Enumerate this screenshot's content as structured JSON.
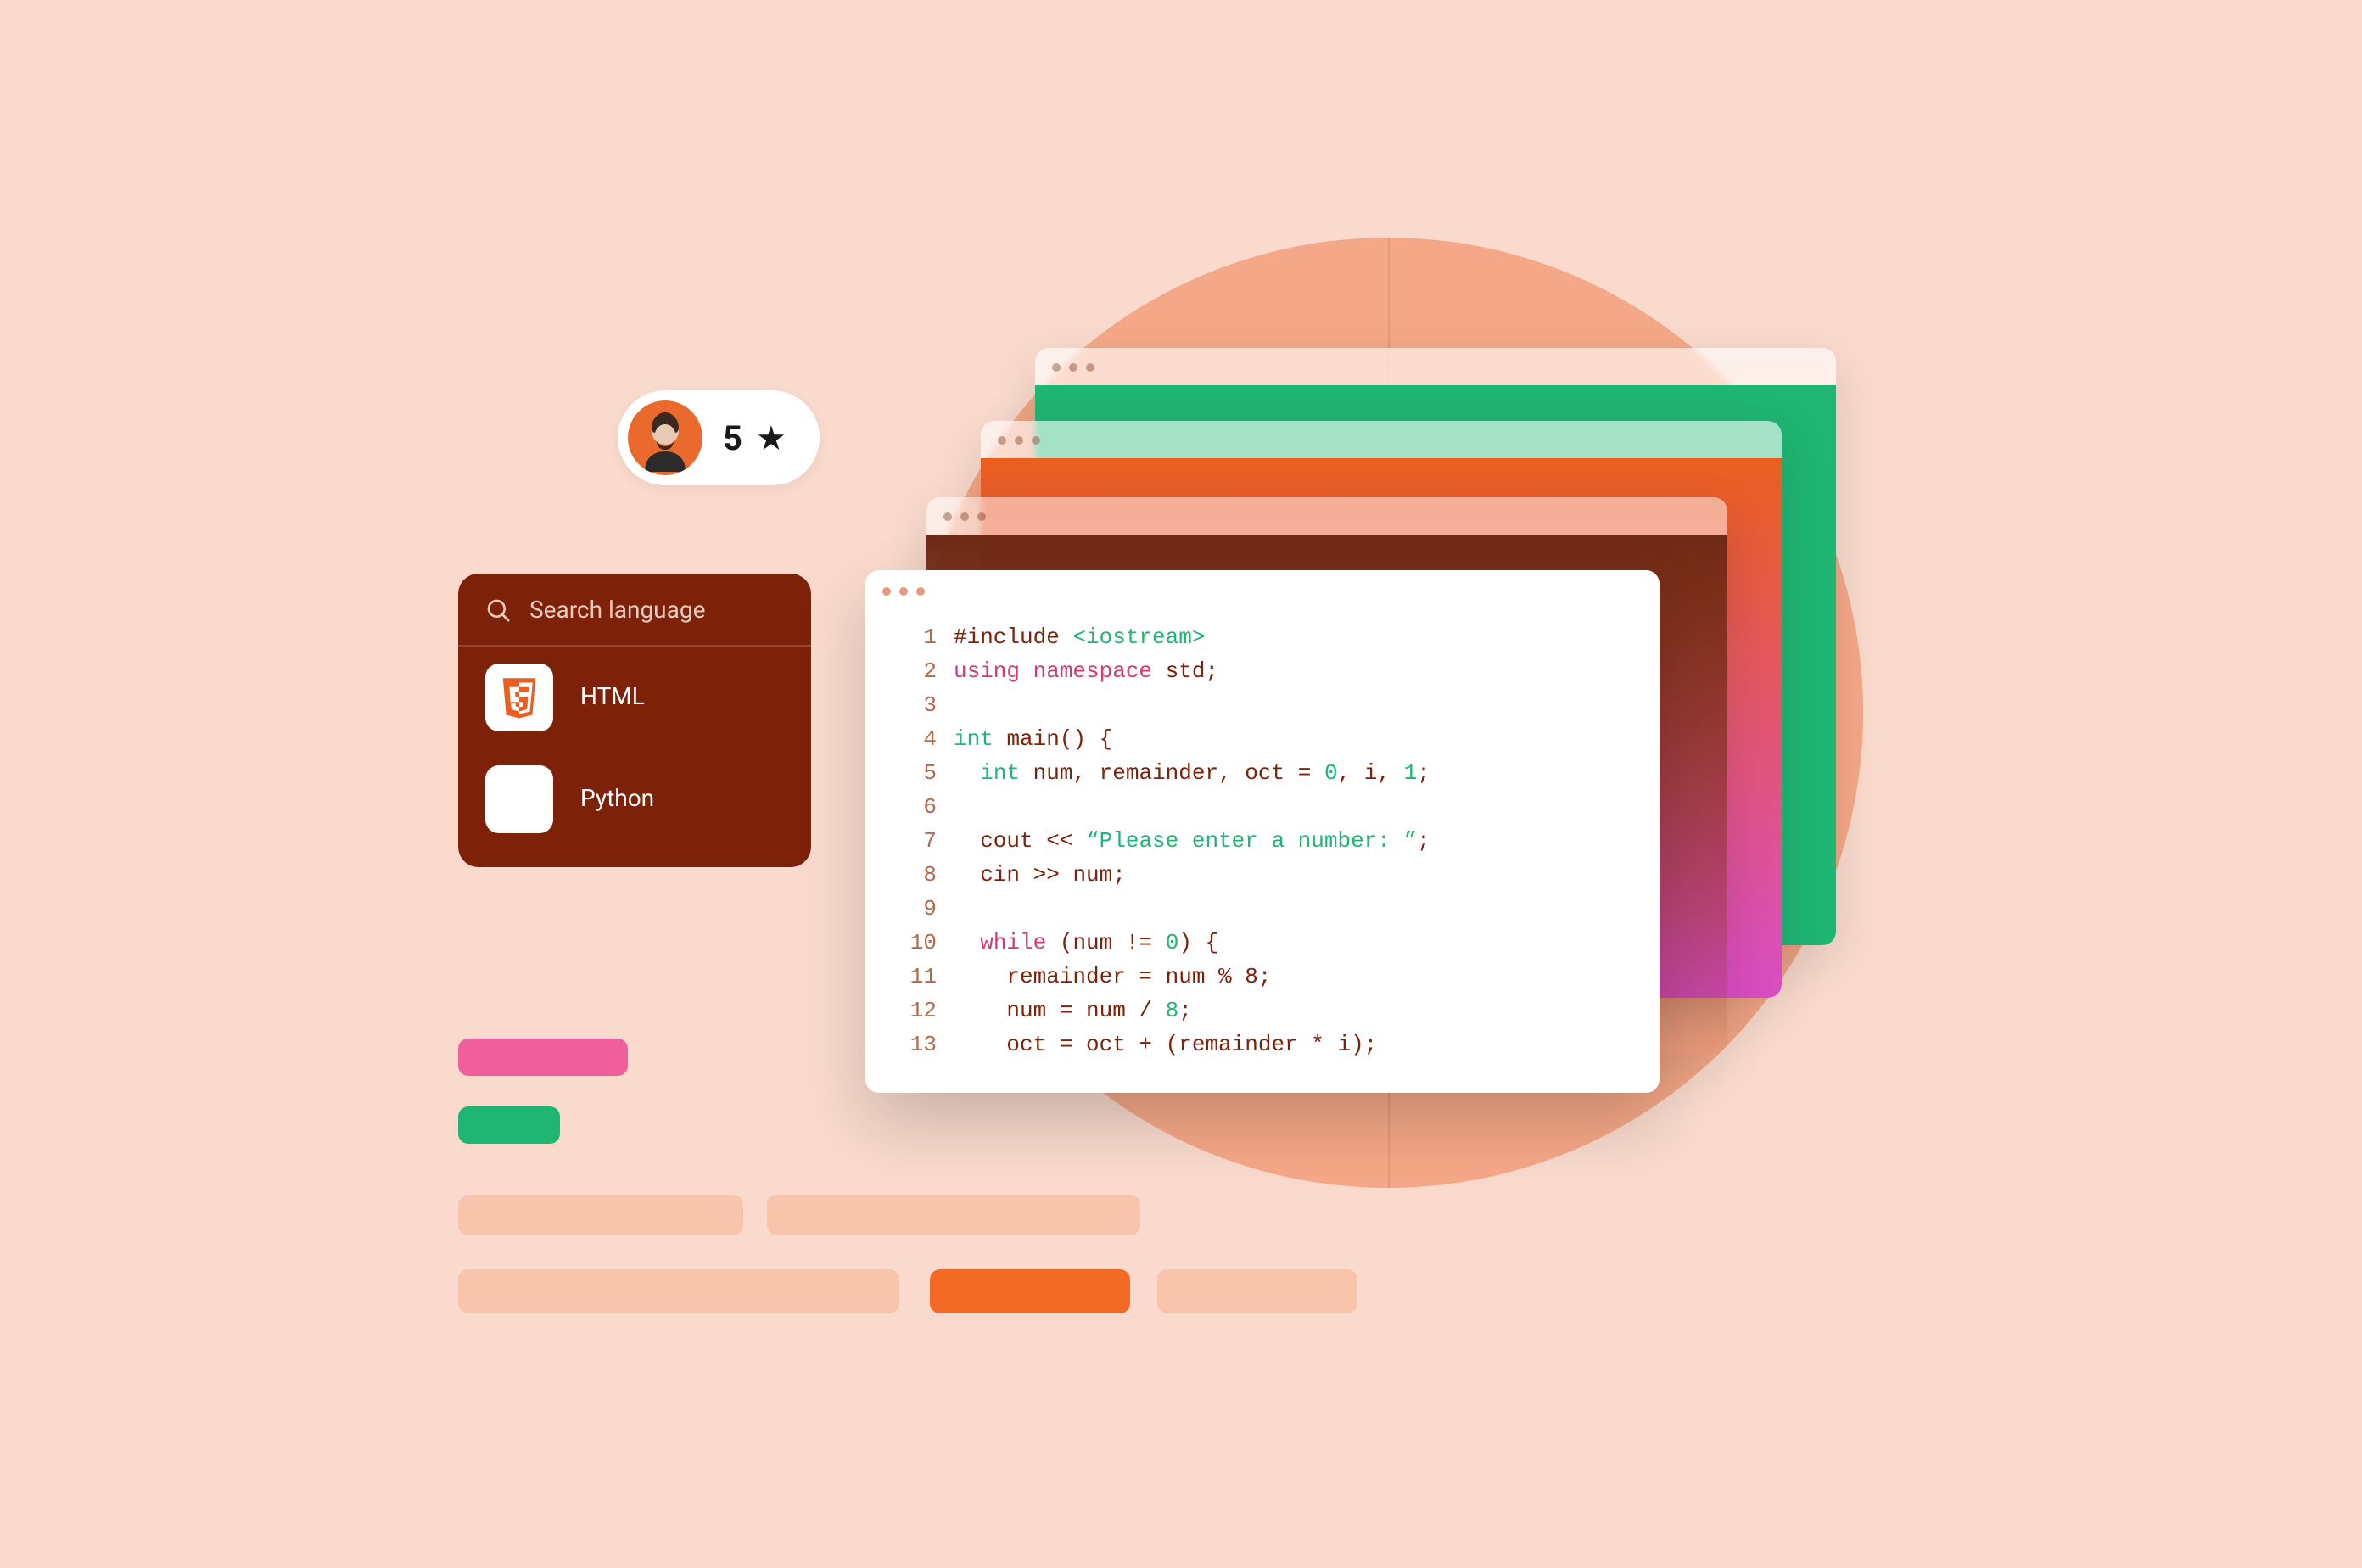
{
  "rating": {
    "value": "5",
    "icon_name": "star-icon"
  },
  "sidebar": {
    "search_placeholder": "Search language",
    "items": [
      {
        "label": "HTML",
        "icon": "html5-icon"
      },
      {
        "label": "Python",
        "icon": "blank-icon"
      }
    ]
  },
  "code": {
    "lines": [
      [
        {
          "t": "pre",
          "v": "#include "
        },
        {
          "t": "inc",
          "v": "<iostream>"
        }
      ],
      [
        {
          "t": "key",
          "v": "using namespace "
        },
        {
          "t": "id",
          "v": "std;"
        }
      ],
      [],
      [
        {
          "t": "type",
          "v": "int "
        },
        {
          "t": "id",
          "v": "main() {"
        }
      ],
      [
        {
          "t": "id",
          "v": "  "
        },
        {
          "t": "type",
          "v": "int "
        },
        {
          "t": "id",
          "v": "num, remainder, oct = "
        },
        {
          "t": "num",
          "v": "0"
        },
        {
          "t": "id",
          "v": ", i, "
        },
        {
          "t": "num",
          "v": "1"
        },
        {
          "t": "id",
          "v": ";"
        }
      ],
      [],
      [
        {
          "t": "id",
          "v": "  cout "
        },
        {
          "t": "op",
          "v": "<< "
        },
        {
          "t": "str",
          "v": "“Please enter a number: ”"
        },
        {
          "t": "id",
          "v": ";"
        }
      ],
      [
        {
          "t": "id",
          "v": "  cin "
        },
        {
          "t": "op",
          "v": ">> "
        },
        {
          "t": "id",
          "v": "num;"
        }
      ],
      [],
      [
        {
          "t": "id",
          "v": "  "
        },
        {
          "t": "key",
          "v": "while "
        },
        {
          "t": "id",
          "v": "(num != "
        },
        {
          "t": "num",
          "v": "0"
        },
        {
          "t": "id",
          "v": ") {"
        }
      ],
      [
        {
          "t": "id",
          "v": "    remainder = num % 8;"
        }
      ],
      [
        {
          "t": "id",
          "v": "    num = num / "
        },
        {
          "t": "num",
          "v": "8"
        },
        {
          "t": "id",
          "v": ";"
        }
      ],
      [
        {
          "t": "id",
          "v": "    oct = oct + (remainder * i);"
        }
      ]
    ]
  },
  "colors": {
    "bg": "#f9dacd",
    "circle": "#f5a887",
    "panel": "#7d2109",
    "green": "#1fb573",
    "orange": "#f26a23",
    "pink": "#f05f9c"
  }
}
